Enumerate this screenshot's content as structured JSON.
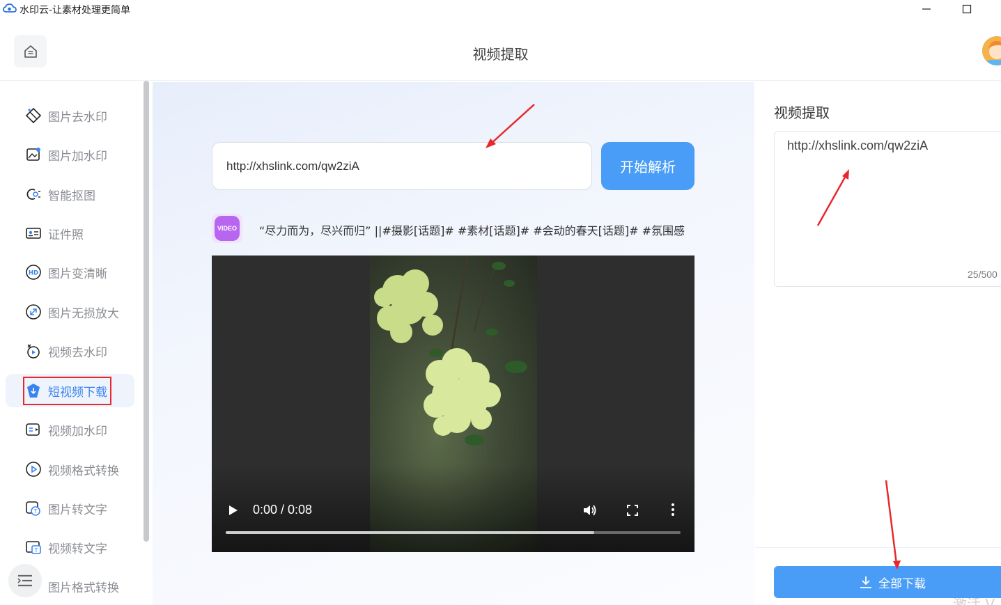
{
  "window": {
    "title": "水印云-让素材处理更简单",
    "minimize_glyph": "—",
    "maximize_glyph": "☐"
  },
  "header": {
    "title": "视频提取",
    "home_icon": "home-icon",
    "avatar": "user-avatar"
  },
  "sidebar": {
    "items": [
      {
        "label": "图片去水印",
        "icon": "eraser-icon"
      },
      {
        "label": "图片加水印",
        "icon": "image-add-icon"
      },
      {
        "label": "智能抠图",
        "icon": "cutout-icon"
      },
      {
        "label": "证件照",
        "icon": "id-photo-icon"
      },
      {
        "label": "图片变清晰",
        "icon": "hd-icon"
      },
      {
        "label": "图片无损放大",
        "icon": "enlarge-icon"
      },
      {
        "label": "视频去水印",
        "icon": "video-remove-icon"
      },
      {
        "label": "短视频下载",
        "icon": "download-icon",
        "active": true
      },
      {
        "label": "视频加水印",
        "icon": "video-add-icon"
      },
      {
        "label": "视频格式转换",
        "icon": "play-circle-icon"
      },
      {
        "label": "图片转文字",
        "icon": "image-text-icon"
      },
      {
        "label": "视频转文字",
        "icon": "video-text-icon"
      },
      {
        "label": "图片格式转换",
        "icon": "format-icon"
      }
    ],
    "menu_icon": "menu-icon"
  },
  "main": {
    "url_value": "http://xhslink.com/qw2ziA",
    "parse_button": "开始解析",
    "badge_text": "VIDEO",
    "video_description": "“尽力而为，尽兴而归” ||#摄影[话题]#  #素材[话题]#  #会动的春天[话题]#  #氛围感",
    "player": {
      "time": "0:00 / 0:08",
      "buffered_fraction": 0.81
    }
  },
  "right_panel": {
    "title": "视频提取",
    "text_value": "http://xhslink.com/qw2ziA",
    "char_count": "25/500",
    "download_all": "全部下载",
    "watermark_text": "激活 V"
  },
  "colors": {
    "accent": "#4a9df7",
    "active_text": "#3a84f0",
    "annotation": "#e8282b"
  }
}
